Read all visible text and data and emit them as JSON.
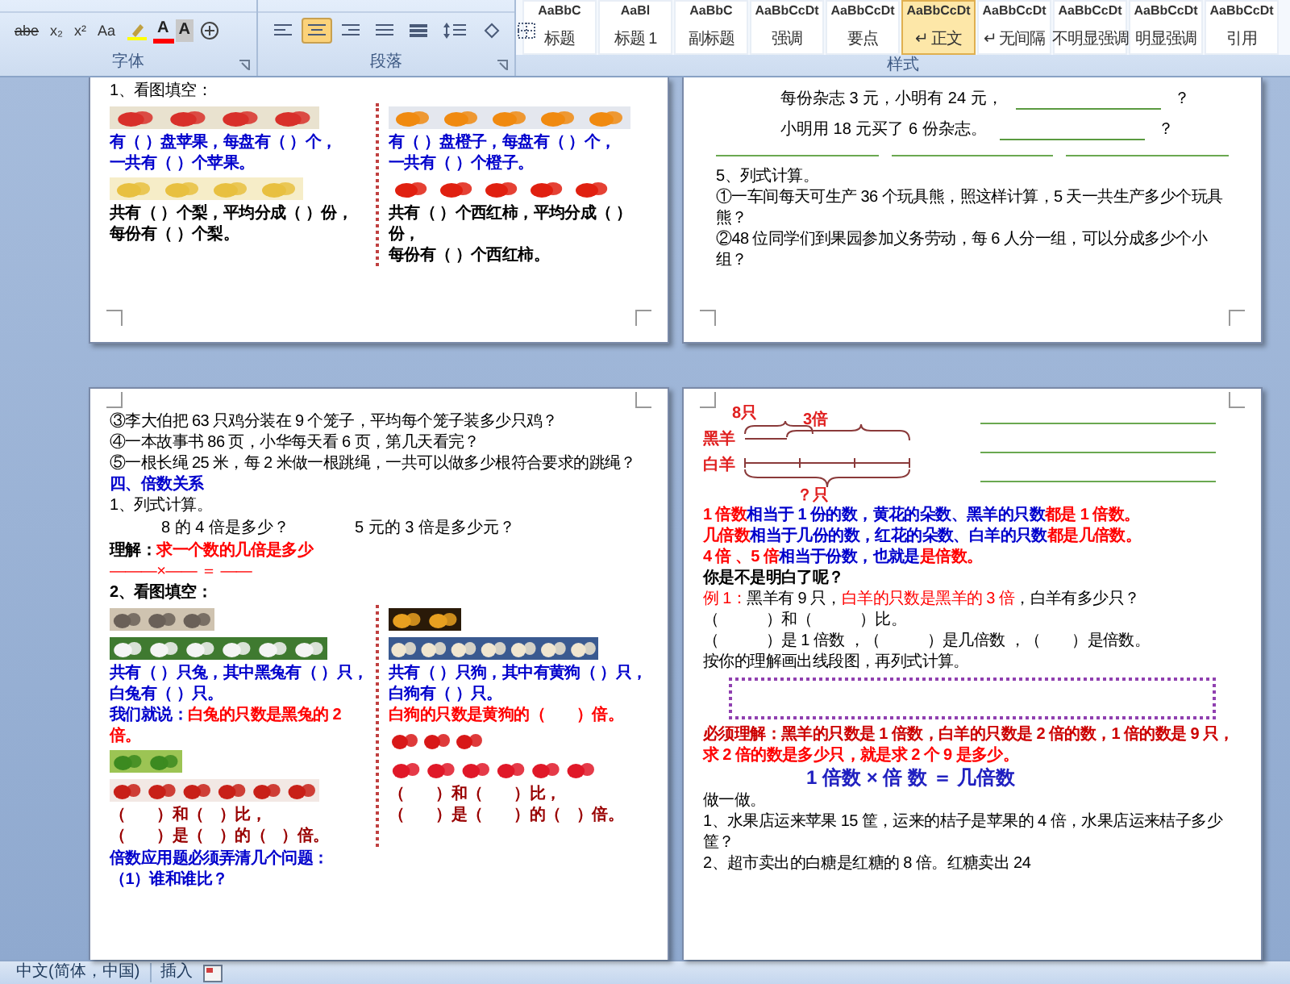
{
  "ribbon": {
    "font_tools": [
      {
        "kind": "strike",
        "label": "abe"
      },
      {
        "kind": "text",
        "label": "x₂"
      },
      {
        "kind": "text",
        "label": "x²"
      },
      {
        "kind": "text",
        "label": "Aa"
      },
      {
        "kind": "highlight"
      },
      {
        "kind": "color",
        "label": "A"
      },
      {
        "kind": "shaded",
        "label": "A"
      },
      {
        "kind": "enclose"
      }
    ],
    "paragraph_tools": [
      {
        "kind": "align-left",
        "selected": false
      },
      {
        "kind": "align-center",
        "selected": true
      },
      {
        "kind": "align-right",
        "selected": false
      },
      {
        "kind": "justify",
        "selected": false
      },
      {
        "kind": "distribute",
        "selected": false
      },
      {
        "kind": "line-spacing",
        "selected": false
      },
      {
        "kind": "shading",
        "selected": false
      },
      {
        "kind": "borders",
        "selected": false
      }
    ],
    "group_labels": [
      "字体",
      "段落",
      "样式"
    ],
    "styles": [
      {
        "preview": "AaBbC",
        "label": "标题",
        "selected": false
      },
      {
        "preview": "AaBl",
        "label": "标题 1",
        "selected": false
      },
      {
        "preview": "AaBbC",
        "label": "副标题",
        "selected": false
      },
      {
        "preview": "AaBbCcDt",
        "label": "强调",
        "selected": false
      },
      {
        "preview": "AaBbCcDt",
        "label": "要点",
        "selected": false
      },
      {
        "preview": "AaBbCcDt",
        "label": "↵ 正文",
        "selected": true
      },
      {
        "preview": "AaBbCcDt",
        "label": "↵ 无间隔",
        "selected": false
      },
      {
        "preview": "AaBbCcDt",
        "label": "不明显强调",
        "selected": false
      },
      {
        "preview": "AaBbCcDt",
        "label": "明显强调",
        "selected": false
      },
      {
        "preview": "AaBbCcDt",
        "label": "引用",
        "selected": false
      }
    ]
  },
  "pages": [
    {
      "blocks": [
        {
          "kind": "line",
          "bold": false,
          "runs": [
            {
              "text": "1、看图填空：",
              "color": "#000000"
            }
          ]
        },
        {
          "kind": "columns",
          "left": [
            {
              "kind": "picture"
            },
            {
              "kind": "line",
              "bold": true,
              "runs": [
                {
                  "text": "有（ ）盘苹果，每盘有（ ）个，",
                  "color": "#0000cc"
                }
              ]
            },
            {
              "kind": "line",
              "bold": true,
              "runs": [
                {
                  "text": "一共有（ ）个苹果。",
                  "color": "#0000cc"
                }
              ]
            },
            {
              "kind": "picture"
            },
            {
              "kind": "line",
              "bold": true,
              "runs": [
                {
                  "text": "共有（ ）个梨，平均分成（ ）份，",
                  "color": "#000000"
                }
              ]
            },
            {
              "kind": "line",
              "bold": true,
              "runs": [
                {
                  "text": "每份有（ ）个梨。",
                  "color": "#000000"
                }
              ]
            }
          ],
          "right": [
            {
              "kind": "picture"
            },
            {
              "kind": "line",
              "bold": true,
              "runs": [
                {
                  "text": "有（ ）盘橙子，每盘有（ ）个，",
                  "color": "#0000cc"
                }
              ]
            },
            {
              "kind": "line",
              "bold": true,
              "runs": [
                {
                  "text": "一共有（ ）个橙子。",
                  "color": "#0000cc"
                }
              ]
            },
            {
              "kind": "picture"
            },
            {
              "kind": "line",
              "bold": true,
              "runs": [
                {
                  "text": "共有（ ）个西红柿，平均分成（ ）份，",
                  "color": "#000000"
                }
              ]
            },
            {
              "kind": "line",
              "bold": true,
              "runs": [
                {
                  "text": "每份有（ ）个西红柿。",
                  "color": "#000000"
                }
              ]
            }
          ]
        }
      ]
    },
    {
      "blocks": [
        {
          "kind": "answer",
          "text": "每份杂志 3 元，小明有 24 元，",
          "mark": "？"
        },
        {
          "kind": "answer",
          "text": "小明用 18 元买了 6 份杂志。",
          "mark": "？"
        },
        {
          "kind": "rules"
        },
        {
          "kind": "line",
          "bold": false,
          "runs": [
            {
              "text": "5、列式计算。",
              "color": "#000000"
            }
          ]
        },
        {
          "kind": "line",
          "bold": false,
          "runs": [
            {
              "text": "①一车间每天可生产 36 个玩具熊，照这样计算，5 天一共生产多少个玩具熊？",
              "color": "#000000"
            }
          ]
        },
        {
          "kind": "line",
          "bold": false,
          "runs": [
            {
              "text": "②48 位同学们到果园参加义务劳动，每 6 人分一组，可以分成多少个小组？",
              "color": "#000000"
            }
          ]
        }
      ]
    },
    {
      "blocks": [
        {
          "kind": "line",
          "bold": false,
          "runs": [
            {
              "text": "③李大伯把 63 只鸡分装在 9 个笼子，平均每个笼子装多少只鸡？",
              "color": "#000000"
            }
          ]
        },
        {
          "kind": "line",
          "bold": false,
          "runs": [
            {
              "text": "④一本故事书 86 页，小华每天看 6 页，第几天看完？",
              "color": "#000000"
            }
          ]
        },
        {
          "kind": "line",
          "bold": false,
          "runs": [
            {
              "text": "⑤一根长绳 25 米，每 2 米做一根跳绳，一共可以做多少根符合要求的跳绳？",
              "color": "#000000"
            }
          ]
        },
        {
          "kind": "line",
          "bold": true,
          "runs": [
            {
              "text": "四、倍数关系",
              "color": "#0000cc"
            }
          ]
        },
        {
          "kind": "line",
          "bold": false,
          "runs": [
            {
              "text": "1、列式计算。",
              "color": "#000000"
            }
          ]
        },
        {
          "kind": "pair",
          "texts": [
            "8 的 4 倍是多少？",
            "5 元的 3 倍是多少元？"
          ]
        },
        {
          "kind": "line",
          "bold": true,
          "runs": [
            {
              "text": "理解：",
              "color": "#000000"
            },
            {
              "text": "求一个数的几倍是多少",
              "color": "#ff0000"
            }
          ]
        },
        {
          "kind": "line",
          "bold": false,
          "runs": [
            {
              "text": "———×—— ＝ ——",
              "color": "#ff0000"
            }
          ]
        },
        {
          "kind": "line",
          "bold": true,
          "runs": [
            {
              "text": "2、看图填空：",
              "color": "#000000"
            }
          ]
        },
        {
          "kind": "columns",
          "left": [
            {
              "kind": "picture"
            },
            {
              "kind": "picture"
            },
            {
              "kind": "line",
              "bold": true,
              "runs": [
                {
                  "text": "共有（ ）只兔，其中黑兔有（ ）只，",
                  "color": "#0000cc"
                }
              ]
            },
            {
              "kind": "line",
              "bold": true,
              "runs": [
                {
                  "text": "白兔有（ ）只。",
                  "color": "#0000cc"
                }
              ]
            },
            {
              "kind": "line",
              "bold": true,
              "runs": [
                {
                  "text": "我们就说：",
                  "color": "#0000cc"
                },
                {
                  "text": "白兔的只数是黑兔的 2 倍。",
                  "color": "#ff0000"
                }
              ]
            },
            {
              "kind": "picture"
            },
            {
              "kind": "picture"
            },
            {
              "kind": "line",
              "bold": true,
              "runs": [
                {
                  "text": "（　　）和（　）比，",
                  "color": "#990000"
                }
              ]
            },
            {
              "kind": "line",
              "bold": true,
              "runs": [
                {
                  "text": "（　　）是（　）的（　）倍。",
                  "color": "#990000"
                }
              ]
            }
          ],
          "right": [
            {
              "kind": "picture"
            },
            {
              "kind": "picture"
            },
            {
              "kind": "line",
              "bold": true,
              "runs": [
                {
                  "text": "共有（ ）只狗，其中有黄狗（ ）只，",
                  "color": "#0000cc"
                }
              ]
            },
            {
              "kind": "line",
              "bold": true,
              "runs": [
                {
                  "text": "白狗有（ ）只。",
                  "color": "#0000cc"
                }
              ]
            },
            {
              "kind": "line",
              "bold": true,
              "runs": [
                {
                  "text": "白狗的只数是黄狗的（　　）倍。",
                  "color": "#ff0000"
                }
              ]
            },
            {
              "kind": "picture"
            },
            {
              "kind": "picture"
            },
            {
              "kind": "line",
              "bold": true,
              "runs": [
                {
                  "text": "（　　）和（　　）比，",
                  "color": "#990000"
                }
              ]
            },
            {
              "kind": "line",
              "bold": true,
              "runs": [
                {
                  "text": "（　　）是（　　）的（　）倍。",
                  "color": "#990000"
                }
              ]
            }
          ]
        },
        {
          "kind": "line",
          "bold": true,
          "runs": [
            {
              "text": "倍数应用题必须弄清几个问题：",
              "color": "#0000cc"
            }
          ]
        },
        {
          "kind": "line",
          "bold": true,
          "runs": [
            {
              "text": "（1）谁和谁比？",
              "color": "#0000cc"
            }
          ]
        }
      ]
    },
    {
      "blocks": [
        {
          "kind": "diagram",
          "top": "8只",
          "multiple": "3倍",
          "row1": "黑羊",
          "row2": "白羊",
          "total": "？只"
        },
        {
          "kind": "line",
          "bold": true,
          "runs": [
            {
              "text": "1 倍数",
              "color": "#ff0000"
            },
            {
              "text": "相当于 1 份的数，黄花的朵数、黑羊的只数",
              "color": "#0000cc"
            },
            {
              "text": "都是 1 倍数。",
              "color": "#ff0000"
            }
          ]
        },
        {
          "kind": "line",
          "bold": true,
          "runs": [
            {
              "text": "几倍数",
              "color": "#ff0000"
            },
            {
              "text": "相当于几份的数，红花的朵数、白羊的只数",
              "color": "#0000cc"
            },
            {
              "text": "都是几倍数。",
              "color": "#ff0000"
            }
          ]
        },
        {
          "kind": "line",
          "bold": true,
          "runs": [
            {
              "text": "4 倍 、5 倍",
              "color": "#ff0000"
            },
            {
              "text": "相当于份数，也就是",
              "color": "#0000cc"
            },
            {
              "text": "是倍数。",
              "color": "#ff0000"
            }
          ]
        },
        {
          "kind": "line",
          "bold": true,
          "runs": [
            {
              "text": "你是不是明白了呢？",
              "color": "#000000"
            }
          ]
        },
        {
          "kind": "line",
          "bold": false,
          "runs": [
            {
              "text": "例 1：",
              "color": "#ff0000"
            },
            {
              "text": "黑羊有 9 只，",
              "color": "#000000"
            },
            {
              "text": "白羊的只数是黑羊的 3 倍",
              "color": "#ff0000"
            },
            {
              "text": "，白羊有多少只？",
              "color": "#000000"
            }
          ]
        },
        {
          "kind": "line",
          "bold": false,
          "runs": [
            {
              "text": "（　　　）和（　　　）比。",
              "color": "#000000"
            }
          ]
        },
        {
          "kind": "line",
          "bold": false,
          "runs": [
            {
              "text": "（　　　）是 1 倍数 ，（　　　）是几倍数 ，（　　）是倍数。",
              "color": "#000000"
            }
          ]
        },
        {
          "kind": "line",
          "bold": false,
          "runs": [
            {
              "text": "按你的理解画出线段图，再列式计算。",
              "color": "#000000"
            }
          ]
        },
        {
          "kind": "box"
        },
        {
          "kind": "line",
          "bold": true,
          "runs": [
            {
              "text": "必须理解：黑羊的只数是 1 倍数，白羊的只数是 2 倍的数，1 倍的数是 9 只，",
              "color": "#cc0000"
            }
          ]
        },
        {
          "kind": "line",
          "bold": true,
          "runs": [
            {
              "text": "求 2 倍的数是多少只，就是求 2 个 9 是多少。",
              "color": "#ff0000"
            }
          ]
        },
        {
          "kind": "formula",
          "text": "1 倍数 × 倍 数 ＝ 几倍数"
        },
        {
          "kind": "line",
          "bold": false,
          "runs": [
            {
              "text": "做一做。",
              "color": "#000000"
            }
          ]
        },
        {
          "kind": "line",
          "bold": false,
          "runs": [
            {
              "text": "1、水果店运来苹果 15 筐，运来的桔子是苹果的 4 倍，水果店运来桔子多少筐？",
              "color": "#000000"
            }
          ]
        },
        {
          "kind": "line",
          "bold": false,
          "runs": [
            {
              "text": "2、超市卖出的白糖是红糖的 8 倍。红糖卖出 24",
              "color": "#000000"
            }
          ]
        }
      ]
    }
  ],
  "status_bar": {
    "language": "中文(简体，中国)",
    "mode": "插入"
  }
}
